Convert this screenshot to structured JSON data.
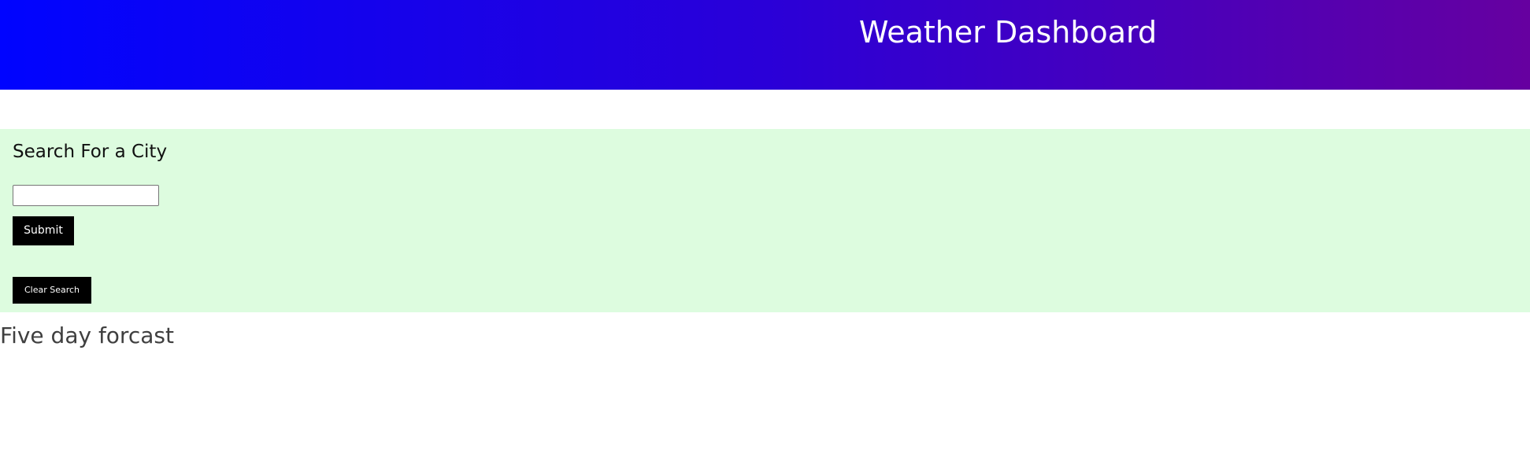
{
  "header": {
    "title": "Weather Dashboard"
  },
  "search": {
    "title": "Search For a City",
    "input_value": "",
    "input_placeholder": "",
    "submit_label": "Submit",
    "clear_label": "Clear Search"
  },
  "forecast": {
    "title": "Five day forcast"
  },
  "colors": {
    "header_gradient_start": "#0004ff",
    "header_gradient_end": "#6600a0",
    "search_panel_background": "#ddfcdf",
    "button_background": "#000000",
    "button_text": "#ffffff"
  }
}
